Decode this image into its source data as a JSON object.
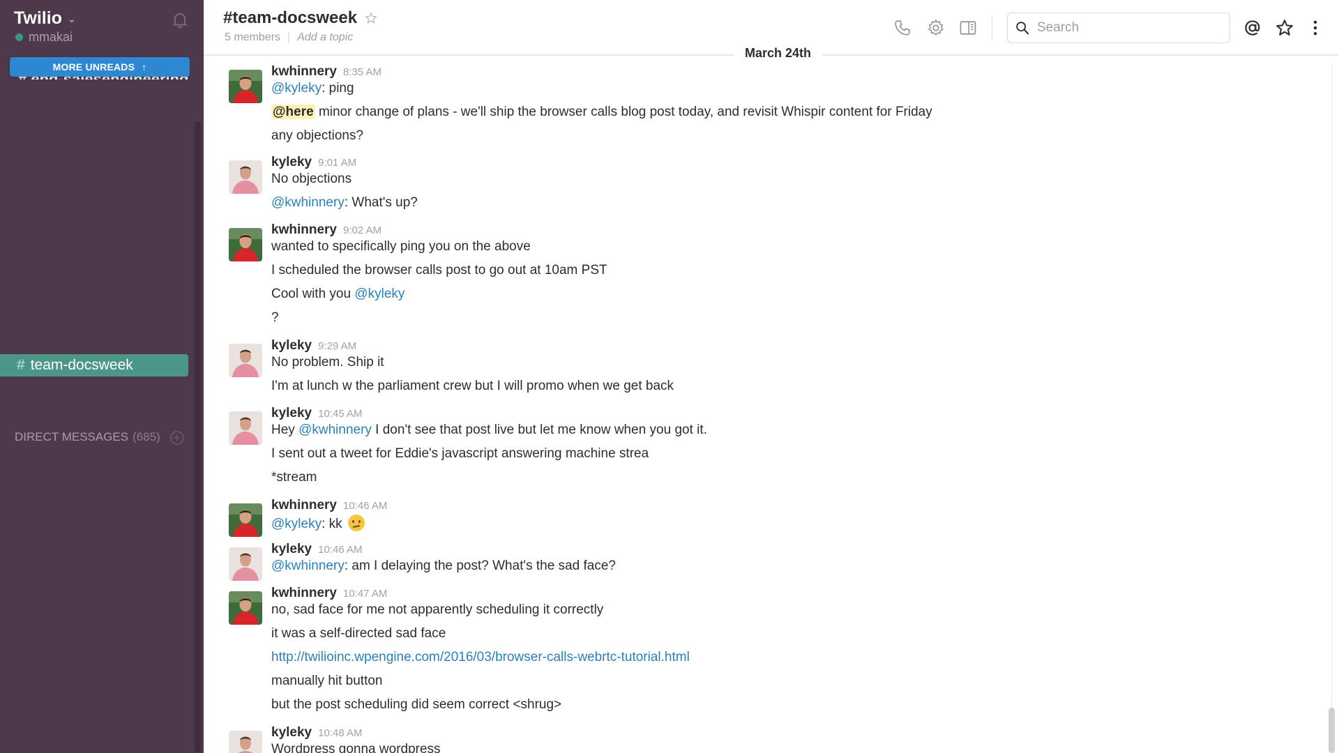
{
  "sidebar": {
    "team_name": "Twilio",
    "username": "mmakai",
    "partial_channel": "# eng-salesengineering",
    "more_unreads": "MORE UNREADS",
    "active_channel": "team-docsweek",
    "direct_messages_label": "DIRECT MESSAGES",
    "direct_messages_count": "(685)"
  },
  "header": {
    "channel_name": "#team-docsweek",
    "members": "5 members",
    "add_topic": "Add a topic",
    "search_placeholder": "Search"
  },
  "date_divider": "March 24th",
  "messages": [
    {
      "sender": "kwhinnery",
      "time": "8:35 AM",
      "lines": [
        "@kyleky: ping",
        "@here minor change of plans - we'll ship the browser calls blog post today, and revisit Whispir content for Friday",
        "any objections?"
      ]
    },
    {
      "sender": "kyleky",
      "time": "9:01 AM",
      "lines": [
        "No objections",
        "@kwhinnery: What's up?"
      ]
    },
    {
      "sender": "kwhinnery",
      "time": "9:02 AM",
      "lines": [
        "wanted to specifically ping you on the above",
        "I scheduled the browser calls post to go out at 10am PST",
        "Cool with you @kyleky",
        "?"
      ]
    },
    {
      "sender": "kyleky",
      "time": "9:29 AM",
      "lines": [
        "No problem. Ship it",
        "I'm at lunch w the parliament crew but I will promo when we get back"
      ]
    },
    {
      "sender": "kyleky",
      "time": "10:45 AM",
      "lines": [
        "Hey @kwhinnery I don't see that post live but let me know when you got it.",
        "I sent out a tweet for Eddie's javascript answering machine strea",
        "*stream"
      ]
    },
    {
      "sender": "kwhinnery",
      "time": "10:46 AM",
      "lines": [
        "@kyleky: kk"
      ]
    },
    {
      "sender": "kyleky",
      "time": "10:46 AM",
      "lines": [
        "@kwhinnery: am I delaying the post? What's the sad face?"
      ]
    },
    {
      "sender": "kwhinnery",
      "time": "10:47 AM",
      "lines": [
        "no, sad face for me not apparently scheduling it correctly",
        "it was a self-directed sad face",
        "http://twilioinc.wpengine.com/2016/03/browser-calls-webrtc-tutorial.html",
        "manually hit button",
        "but the post scheduling did seem correct <shrug>"
      ]
    },
    {
      "sender": "kyleky",
      "time": "10:48 AM",
      "lines": [
        "Wordpress gonna wordpress"
      ]
    }
  ],
  "mentions": {
    "kyleky": "@kyleky",
    "kwhinnery": "@kwhinnery",
    "here": "@here"
  },
  "fragments": {
    "m0l0_rest": ": ping",
    "m0l1_rest": " minor change of plans - we'll ship the browser calls blog post today, and revisit Whispir content for Friday",
    "m1l1_rest": ": What's up?",
    "m2l2_pre": "Cool with you ",
    "m4l0_pre": "Hey ",
    "m4l0_rest": " I don't see that post live but let me know when you got it.",
    "m5l0_rest": ": kk",
    "m6l0_rest": ": am I delaying the post? What's the sad face?"
  },
  "emoji": "confused-face",
  "colors": {
    "sidebar_bg": "#4d394b",
    "active_channel": "#4c9689",
    "more_unreads": "#2d88d1",
    "mention": "#2a80b9",
    "presence": "#38978d"
  }
}
